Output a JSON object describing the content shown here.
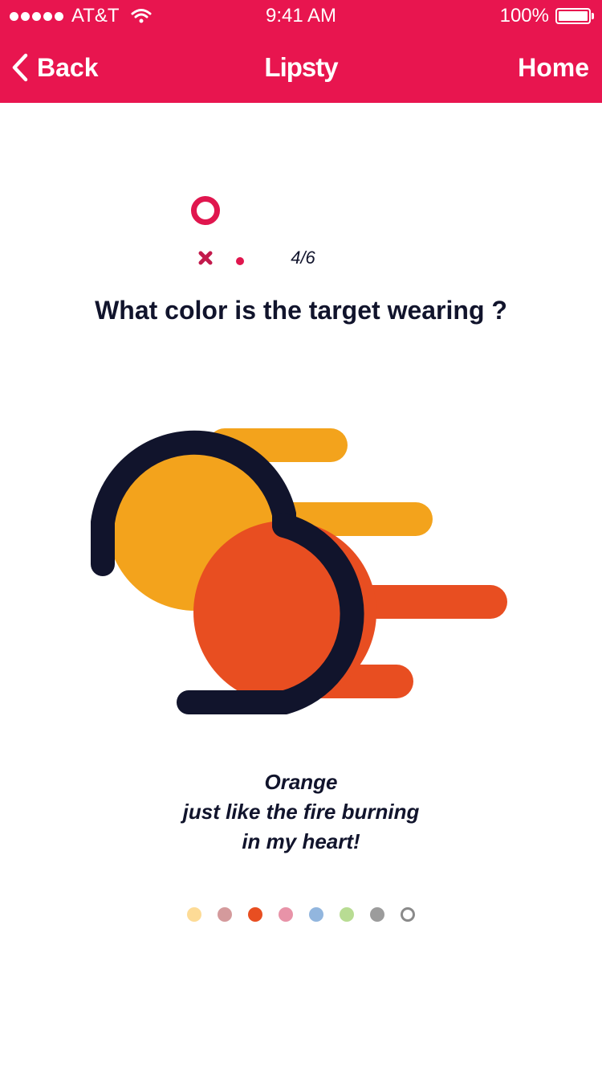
{
  "status_bar": {
    "carrier": "AT&T",
    "time": "9:41 AM",
    "battery": "100%"
  },
  "nav": {
    "back_label": "Back",
    "title": "Lipsty",
    "home_label": "Home"
  },
  "quiz": {
    "progress": "4/6",
    "question": "What color is the target wearing ?",
    "answer_lines": [
      "Orange",
      "just like the fire burning",
      "in my heart!"
    ]
  },
  "colors": {
    "brand": "#e8154f",
    "dark": "#11142c",
    "orange": "#e84e21",
    "yellow": "#f3a31c"
  },
  "color_dots": [
    {
      "name": "light-yellow",
      "color": "#fddb96",
      "selected": false
    },
    {
      "name": "dusty-rose",
      "color": "#d49a9c",
      "selected": false
    },
    {
      "name": "orange",
      "color": "#e84e21",
      "selected": true
    },
    {
      "name": "pink",
      "color": "#e893a8",
      "selected": false
    },
    {
      "name": "light-blue",
      "color": "#92b6de",
      "selected": false
    },
    {
      "name": "light-green",
      "color": "#b8dc93",
      "selected": false
    },
    {
      "name": "gray",
      "color": "#9c9c9c",
      "selected": false
    },
    {
      "name": "outline",
      "color": "#8a8a8a",
      "selected": false
    }
  ]
}
